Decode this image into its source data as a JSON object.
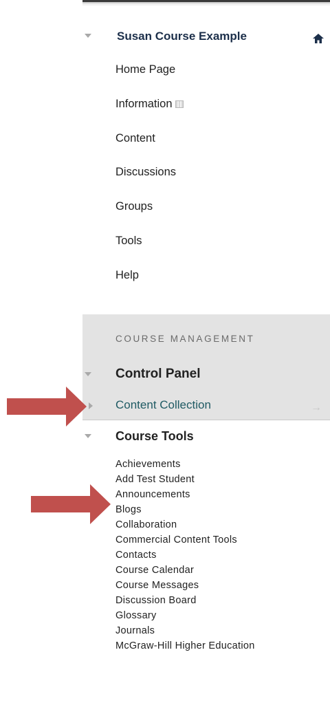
{
  "course": {
    "title": "Susan Course Example",
    "home_icon": "home-icon",
    "nav_items": [
      {
        "label": "Home Page"
      },
      {
        "label": "Information",
        "icon": "small-grid-icon"
      },
      {
        "label": "Content"
      },
      {
        "label": "Discussions"
      },
      {
        "label": "Groups"
      },
      {
        "label": "Tools"
      },
      {
        "label": "Help"
      }
    ]
  },
  "management": {
    "heading": "COURSE MANAGEMENT",
    "control_panel": "Control Panel",
    "content_collection": "Content Collection",
    "course_tools": {
      "label": "Course Tools",
      "items": [
        "Achievements",
        "Add Test Student",
        "Announcements",
        "Blogs",
        "Collaboration",
        "Commercial Content Tools",
        "Contacts",
        "Course Calendar",
        "Course Messages",
        "Discussion Board",
        "Glossary",
        "Journals",
        "McGraw-Hill Higher Education"
      ]
    }
  },
  "annotations": {
    "arrow_color": "#c0504d"
  }
}
